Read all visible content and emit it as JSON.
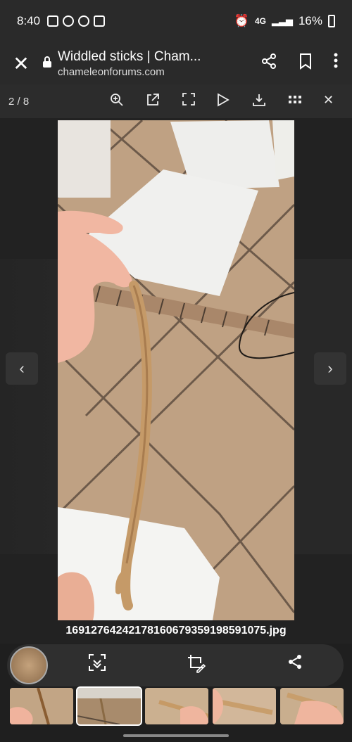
{
  "status_bar": {
    "time": "8:40",
    "network": "4G",
    "battery": "16%"
  },
  "browser_bar": {
    "page_title": "Widdled sticks | Cham...",
    "url": "chameleonforums.com",
    "icons": [
      "close-icon",
      "lock-icon",
      "share-icon",
      "bookmark-icon",
      "more-vert-icon"
    ]
  },
  "viewer": {
    "counter": "2 / 8",
    "tool_icons": [
      "zoom-in-icon",
      "open-external-icon",
      "fullscreen-icon",
      "play-icon",
      "download-icon",
      "grid-icon",
      "close-icon"
    ],
    "filename": "16912764242178160679359198591075.jpg"
  },
  "bottom_actions": {
    "icons": [
      "scan-icon",
      "crop-edit-icon",
      "share-icon"
    ]
  },
  "thumbnails_count": 5
}
